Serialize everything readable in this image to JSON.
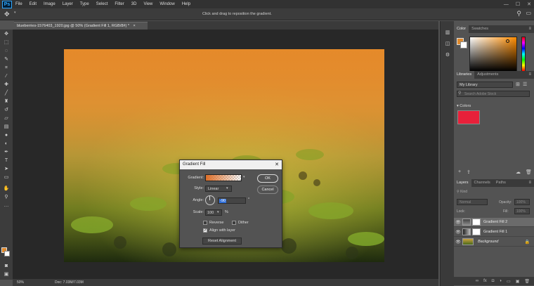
{
  "app": {
    "logo": "Ps"
  },
  "menubar": {
    "items": [
      "File",
      "Edit",
      "Image",
      "Layer",
      "Type",
      "Select",
      "Filter",
      "3D",
      "View",
      "Window",
      "Help"
    ]
  },
  "window_controls": {
    "minimize": "—",
    "maximize": "☐",
    "close": "✕"
  },
  "options_bar": {
    "hint": "Click and drag to reposition the gradient."
  },
  "document": {
    "tab_title": "blueberries-1576403_1920.jpg @ 50% (Gradient Fill 1, RGB/8#) *",
    "tab_close": "×"
  },
  "status": {
    "zoom": "50%",
    "doc_size": "Doc: 7.03M/7.03M"
  },
  "color_panel": {
    "tabs": [
      "Color",
      "Swatches"
    ],
    "active_tab": "Color",
    "foreground": "#e08a2c",
    "background": "#ffffff"
  },
  "libraries_panel": {
    "tabs": [
      "Libraries",
      "Adjustments"
    ],
    "library_name": "My Library",
    "search_placeholder": "Search Adobe Stock",
    "group_name": "Colors",
    "swatch_color": "#e8203a"
  },
  "layers_panel": {
    "tabs": [
      "Layers",
      "Channels",
      "Paths"
    ],
    "filter_label": "Kind",
    "blend_mode": "Normal",
    "opacity_label": "Opacity:",
    "opacity_value": "100%",
    "lock_label": "Lock:",
    "fill_label": "Fill:",
    "fill_value": "100%",
    "layers": [
      {
        "name": "Gradient Fill 2",
        "selected": true
      },
      {
        "name": "Gradient Fill 1",
        "selected": false
      },
      {
        "name": "Background",
        "selected": false
      }
    ]
  },
  "dialog": {
    "title": "Gradient Fill",
    "close": "✕",
    "gradient_label": "Gradient:",
    "style_label": "Style:",
    "style_value": "Linear",
    "angle_label": "Angle:",
    "angle_value": "-90",
    "angle_unit": "°",
    "scale_label": "Scale:",
    "scale_value": "100",
    "scale_unit": "%",
    "reverse_label": "Reverse",
    "reverse_checked": false,
    "dither_label": "Dither",
    "dither_checked": false,
    "align_label": "Align with layer",
    "align_checked": true,
    "reset_label": "Reset Alignment",
    "ok_label": "OK",
    "cancel_label": "Cancel"
  }
}
